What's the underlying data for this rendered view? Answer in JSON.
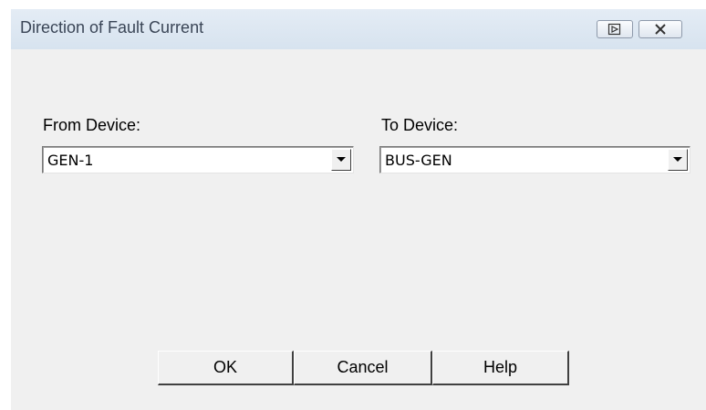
{
  "window": {
    "title": "Direction of Fault Current",
    "restore_icon": "restore-icon",
    "close_icon": "close-icon"
  },
  "from_device": {
    "label": "From Device:",
    "value": "GEN-1"
  },
  "to_device": {
    "label": "To Device:",
    "value": "BUS-GEN"
  },
  "buttons": {
    "ok": "OK",
    "cancel": "Cancel",
    "help": "Help"
  }
}
